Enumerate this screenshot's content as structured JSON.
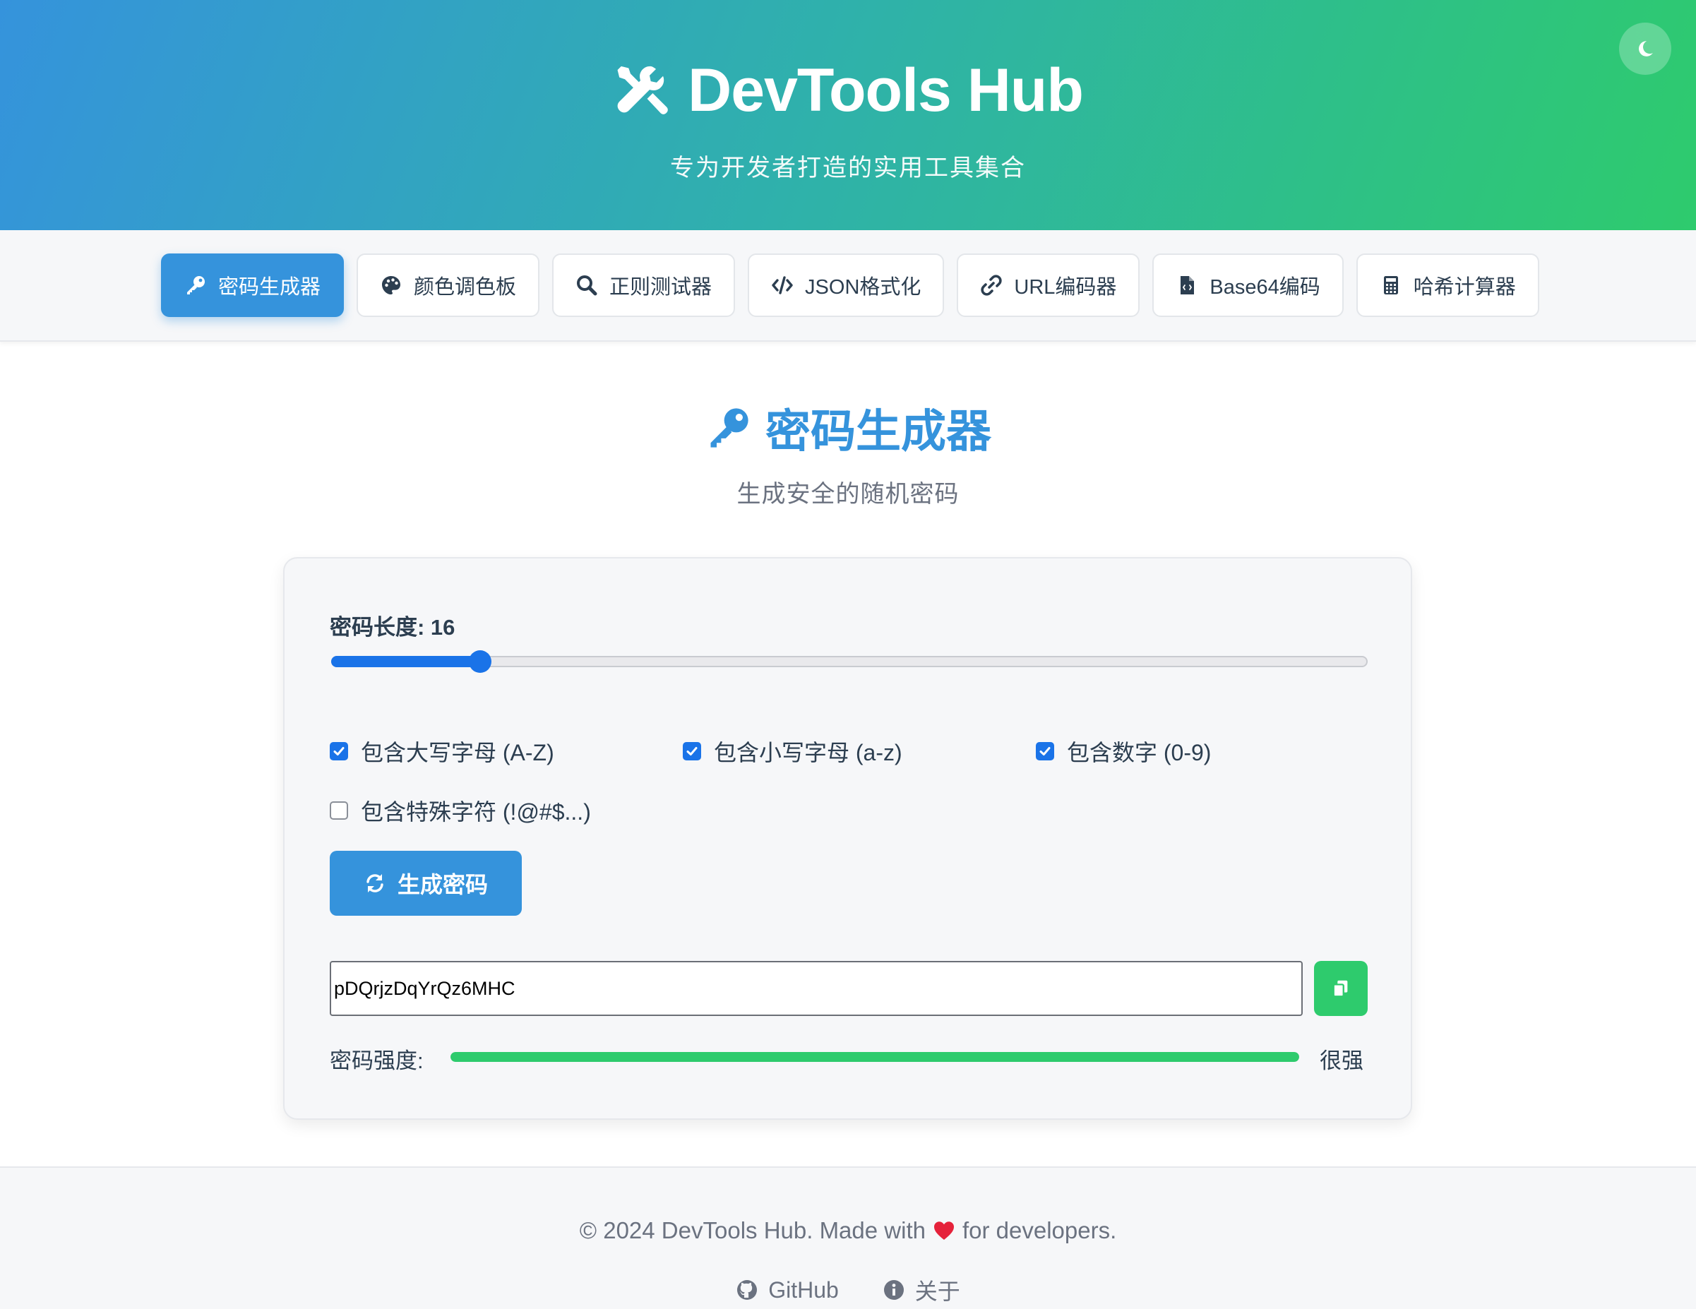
{
  "header": {
    "title": "DevTools Hub",
    "subtitle": "专为开发者打造的实用工具集合",
    "brand_icon": "tools-icon",
    "theme_toggle_icon": "moon-icon"
  },
  "nav": {
    "tabs": [
      {
        "label": "密码生成器",
        "icon": "key-icon",
        "active": true
      },
      {
        "label": "颜色调色板",
        "icon": "palette-icon",
        "active": false
      },
      {
        "label": "正则测试器",
        "icon": "search-icon",
        "active": false
      },
      {
        "label": "JSON格式化",
        "icon": "code-icon",
        "active": false
      },
      {
        "label": "URL编码器",
        "icon": "link-icon",
        "active": false
      },
      {
        "label": "Base64编码",
        "icon": "file-code-icon",
        "active": false
      },
      {
        "label": "哈希计算器",
        "icon": "calculator-icon",
        "active": false
      }
    ]
  },
  "section": {
    "title": "密码生成器",
    "subtitle": "生成安全的随机密码"
  },
  "generator": {
    "length_label": "密码长度: 16",
    "length": 16,
    "length_min": 8,
    "length_max": 64,
    "options": [
      {
        "label": "包含大写字母 (A-Z)",
        "checked": true
      },
      {
        "label": "包含小写字母 (a-z)",
        "checked": true
      },
      {
        "label": "包含数字 (0-9)",
        "checked": true
      },
      {
        "label": "包含特殊字符 (!@#$...)",
        "checked": false
      }
    ],
    "generate_label": "生成密码",
    "password": "pDQrjzDqYrQz6MHC",
    "strength_label": "密码强度:",
    "strength_percent": 100,
    "strength_text": "很强"
  },
  "footer": {
    "copyright": "© 2024 DevTools Hub. Made with",
    "copyright_tail": "for developers.",
    "links": [
      {
        "label": "GitHub",
        "icon": "github-icon"
      },
      {
        "label": "关于",
        "icon": "info-icon"
      }
    ]
  },
  "colors": {
    "primary": "#3593dc",
    "accent_green": "#2ecb6d",
    "checkbox_blue": "#1a73e8"
  }
}
